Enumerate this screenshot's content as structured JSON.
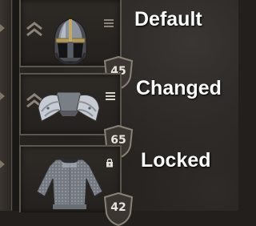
{
  "slots": [
    {
      "status_label": "Default",
      "item": "helmet",
      "value": "45",
      "has_menu": true,
      "menu_bright": false,
      "has_lock": false
    },
    {
      "status_label": "Changed",
      "item": "shoulder-armor",
      "value": "65",
      "has_menu": true,
      "menu_bright": true,
      "has_lock": false
    },
    {
      "status_label": "Locked",
      "item": "chainmail-body-armor",
      "value": "42",
      "has_menu": false,
      "has_lock": true
    }
  ],
  "colors": {
    "label_text": "#ffffff",
    "frame": "#5c554c",
    "chevron": "#8c8478",
    "shield_fill": "#3b3632",
    "shield_border": "#8a8276"
  },
  "icons": {
    "upgrade": "double-chevron-up-icon",
    "menu": "hamburger-menu-icon",
    "lock": "padlock-icon",
    "value_badge": "shield-badge-icon"
  }
}
